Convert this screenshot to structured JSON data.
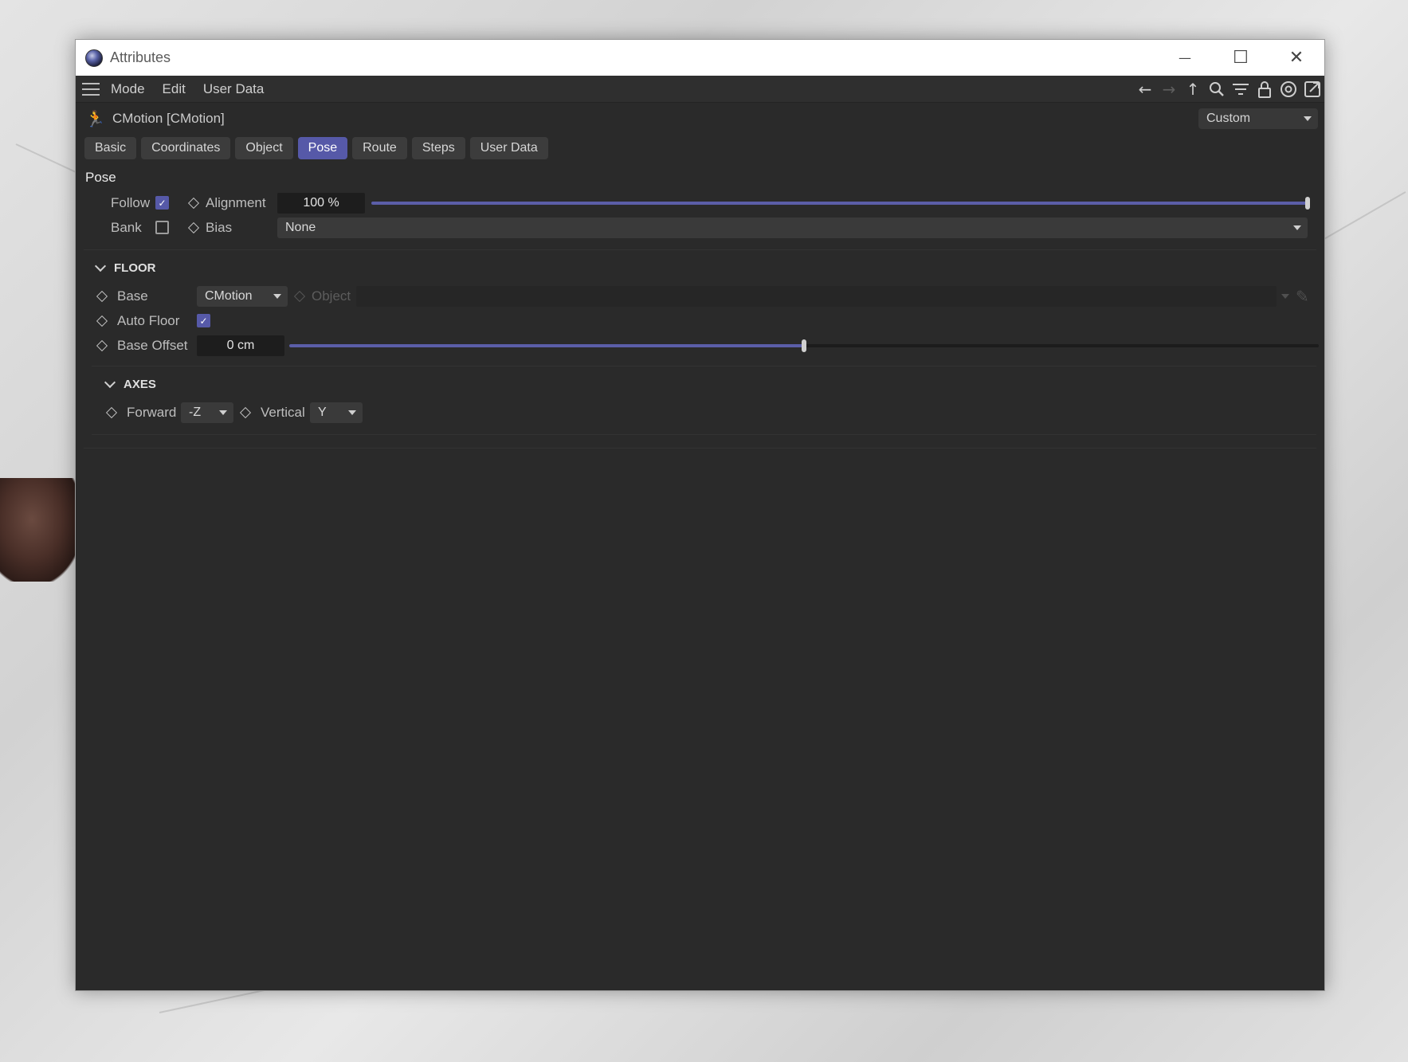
{
  "window": {
    "title": "Attributes",
    "controls": {
      "minimize": "—",
      "maximize": "☐",
      "close": "✕"
    }
  },
  "menubar": {
    "items": [
      "Mode",
      "Edit",
      "User Data"
    ],
    "icons": [
      "back-arrow-icon",
      "forward-arrow-icon",
      "up-arrow-icon",
      "search-icon",
      "filter-icon",
      "lock-icon",
      "target-icon",
      "new-window-icon"
    ]
  },
  "object": {
    "name": "CMotion [CMotion]",
    "preset": "Custom"
  },
  "tabs": [
    "Basic",
    "Coordinates",
    "Object",
    "Pose",
    "Route",
    "Steps",
    "User Data"
  ],
  "active_tab": "Pose",
  "pose": {
    "section_title": "Pose",
    "follow_label": "Follow",
    "follow_checked": true,
    "alignment_label": "Alignment",
    "alignment_value": "100 %",
    "alignment_fraction": 1.0,
    "bank_label": "Bank",
    "bank_checked": false,
    "bias_label": "Bias",
    "bias_value": "None"
  },
  "floor": {
    "title": "FLOOR",
    "base_label": "Base",
    "base_value": "CMotion",
    "object_label": "Object",
    "auto_floor_label": "Auto Floor",
    "auto_floor_checked": true,
    "base_offset_label": "Base Offset",
    "base_offset_value": "0 cm",
    "base_offset_fraction": 0.5
  },
  "axes": {
    "title": "AXES",
    "forward_label": "Forward",
    "forward_value": "-Z",
    "vertical_label": "Vertical",
    "vertical_value": "Y"
  },
  "colors": {
    "accent": "#5659a8",
    "panel_bg": "#2a2a2a"
  }
}
